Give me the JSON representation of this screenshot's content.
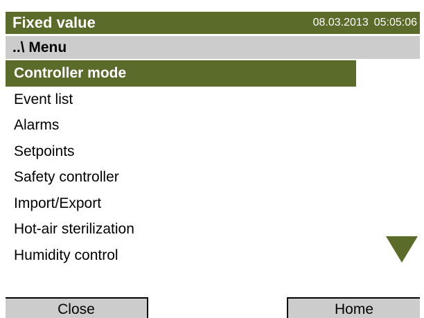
{
  "colors": {
    "accent": "#5b6b2a",
    "bar_gray": "#cccccc",
    "text": "#000000",
    "text_on_accent": "#ffffff"
  },
  "header": {
    "title": "Fixed value",
    "date": "08.03.2013",
    "time": "05:05:06"
  },
  "breadcrumb": {
    "label": "..\\ Menu"
  },
  "menu": {
    "items": [
      {
        "label": "Controller mode",
        "selected": true
      },
      {
        "label": "Event list"
      },
      {
        "label": "Alarms"
      },
      {
        "label": "Setpoints"
      },
      {
        "label": "Safety controller"
      },
      {
        "label": "Import/Export"
      },
      {
        "label": "Hot-air sterilization"
      },
      {
        "label": "Humidity control"
      }
    ],
    "scroll_icon": "triangle-down-icon"
  },
  "footer": {
    "close_label": "Close",
    "home_label": "Home"
  }
}
